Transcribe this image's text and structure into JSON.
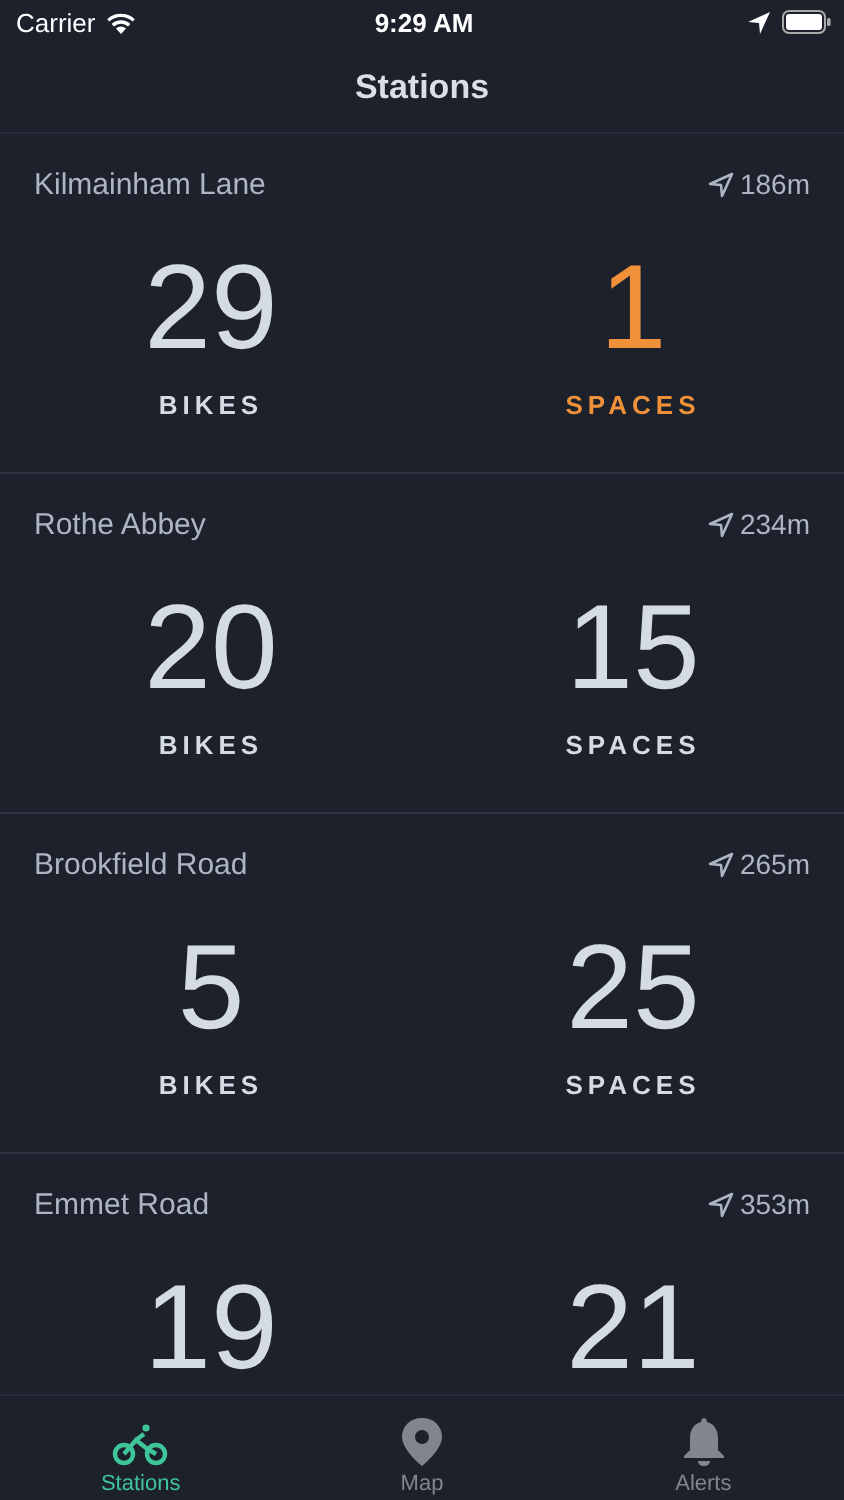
{
  "status_bar": {
    "carrier": "Carrier",
    "time": "9:29 AM"
  },
  "title": "Stations",
  "stations": [
    {
      "name": "Kilmainham Lane",
      "distance": "186m",
      "counts": [
        {
          "value": "29",
          "label": "BIKES",
          "low": false
        },
        {
          "value": "1",
          "label": "SPACES",
          "low": true
        }
      ]
    },
    {
      "name": "Rothe Abbey",
      "distance": "234m",
      "counts": [
        {
          "value": "20",
          "label": "BIKES",
          "low": false
        },
        {
          "value": "15",
          "label": "SPACES",
          "low": false
        }
      ]
    },
    {
      "name": "Brookfield Road",
      "distance": "265m",
      "counts": [
        {
          "value": "5",
          "label": "BIKES",
          "low": false
        },
        {
          "value": "25",
          "label": "SPACES",
          "low": false
        }
      ]
    },
    {
      "name": "Emmet Road",
      "distance": "353m",
      "counts": [
        {
          "value": "19",
          "low": false
        },
        {
          "value": "21",
          "low": false
        }
      ]
    }
  ],
  "tabs": [
    {
      "label": "Stations",
      "kind": "bike",
      "selected": true
    },
    {
      "label": "Map",
      "kind": "pin",
      "selected": false
    },
    {
      "label": "Alerts",
      "kind": "bell",
      "selected": false
    }
  ]
}
